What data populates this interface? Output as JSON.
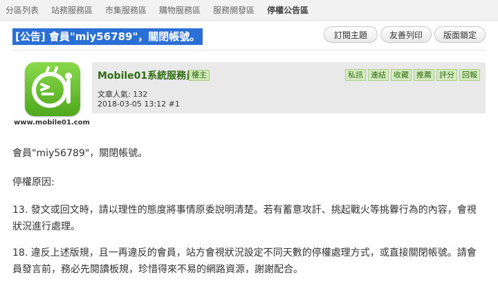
{
  "nav": {
    "items": [
      "分區列表",
      "站務服務區",
      "市集服務區",
      "購物服務區",
      "服務開發區",
      "停權公告區"
    ],
    "active_index": 5
  },
  "thread": {
    "title": "[公告] 會員\"miy56789\"，關閉帳號。",
    "toolbar": [
      "訂閱主題",
      "友善列印",
      "版面鎖定"
    ]
  },
  "post": {
    "avatar_text": "www.mobile01.com",
    "username": "Mobile01系統服務員",
    "role": "樓主",
    "popularity": "文章人氣: 132",
    "datetime": "2018-03-05 13:12",
    "floor": "#1",
    "actions": [
      "私訊",
      "連結",
      "收藏",
      "推薦",
      "評分",
      "回報"
    ],
    "paragraphs": [
      "會員\"miy56789\"，關閉帳號。",
      "停權原因:",
      "13. 發文或回文時，請以理性的態度將事情原委說明清楚。若有蓄意攻訐、挑起戰火等挑釁行為的內容，會視狀況進行處理。",
      "18. 違反上述版規，且一再違反的會員，站方會視狀況設定不同天數的停權處理方式，或直接關閉帳號。請會員發言前，務必先閱讀板規，珍惜得來不易的網路資源，謝謝配合。"
    ]
  },
  "colors": {
    "title_bg": "#2a6fd6",
    "username": "#2f6c12",
    "userbox_bg": "#e9e9e9"
  }
}
